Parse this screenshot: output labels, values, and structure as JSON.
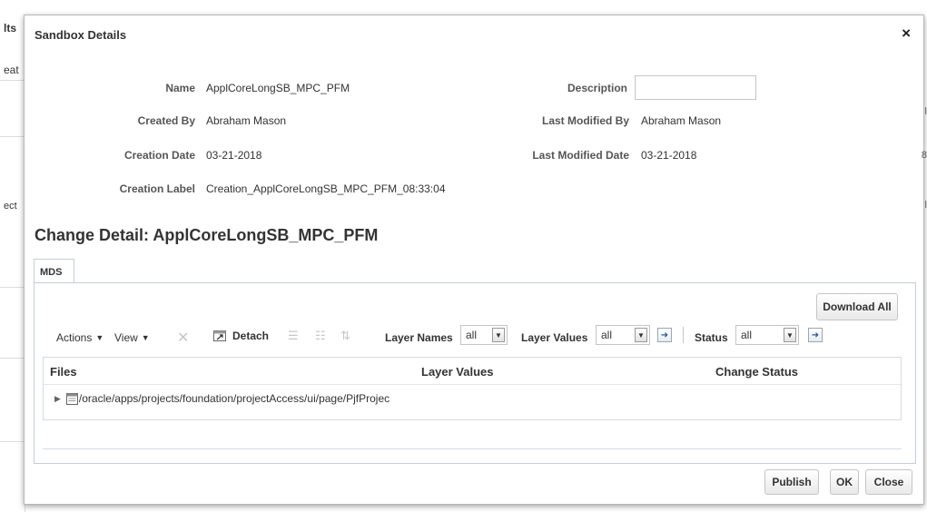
{
  "background": {
    "left_fragments": [
      "lts",
      "eat",
      "ect"
    ],
    "right_fragments": [
      "l",
      "8",
      "l"
    ]
  },
  "modal": {
    "title": "Sandbox Details",
    "close_glyph": "×",
    "details": {
      "name_label": "Name",
      "name_value": "ApplCoreLongSB_MPC_PFM",
      "created_by_label": "Created By",
      "created_by_value": "Abraham Mason",
      "creation_date_label": "Creation Date",
      "creation_date_value": "03-21-2018",
      "creation_label_label": "Creation Label",
      "creation_label_value": "Creation_ApplCoreLongSB_MPC_PFM_08:33:04",
      "description_label": "Description",
      "description_value": "",
      "last_modified_by_label": "Last Modified By",
      "last_modified_by_value": "Abraham Mason",
      "last_modified_date_label": "Last Modified Date",
      "last_modified_date_value": "03-21-2018"
    },
    "change_detail_title": "Change Detail: ApplCoreLongSB_MPC_PFM",
    "tabs": [
      {
        "label": "MDS"
      }
    ],
    "download_all_label": "Download All",
    "toolbar": {
      "actions_label": "Actions",
      "view_label": "View",
      "detach_label": "Detach",
      "layer_names_label": "Layer Names",
      "layer_names_value": "all",
      "layer_values_label": "Layer Values",
      "layer_values_value": "all",
      "status_label": "Status",
      "status_value": "all"
    },
    "table": {
      "columns": [
        "Files",
        "Layer Values",
        "Change Status"
      ],
      "rows": [
        {
          "file": "/oracle/apps/projects/foundation/projectAccess/ui/page/PjfProjec",
          "layer_values": "",
          "change_status": ""
        }
      ]
    },
    "footer": {
      "publish_label": "Publish",
      "ok_label": "OK",
      "close_label": "Close"
    }
  },
  "icons": {
    "close": "close-icon",
    "dropdown": "triangle-down-icon",
    "delete": "delete-x-icon",
    "detach": "detach-icon",
    "go": "go-arrow-icon",
    "expand": "expand-triangle-icon",
    "file": "file-icon"
  }
}
